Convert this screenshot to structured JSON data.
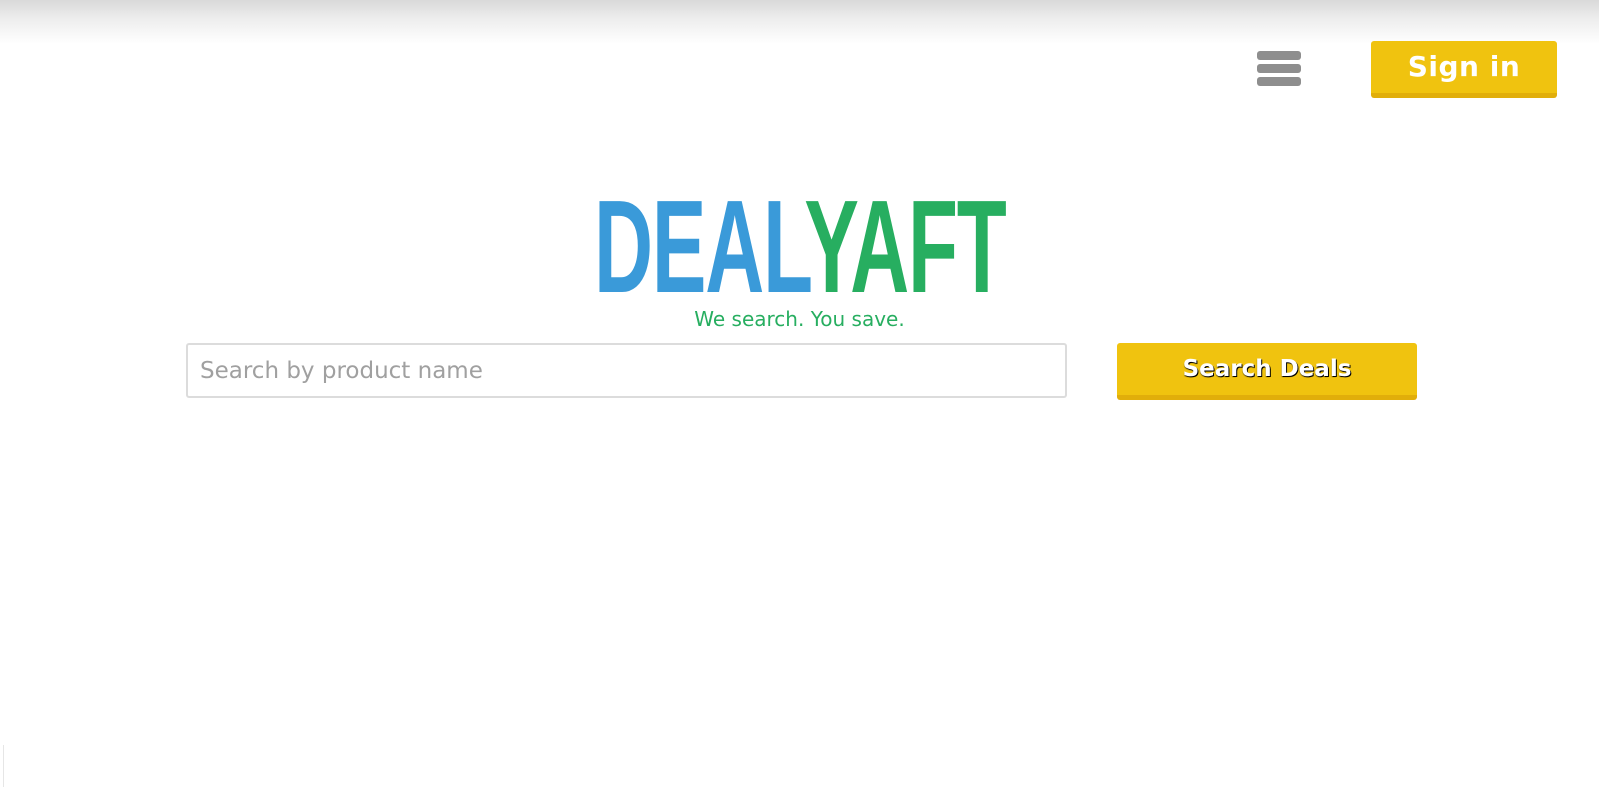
{
  "header": {
    "menu_icon": "hamburger-menu-icon",
    "signin_label": "Sign in"
  },
  "logo": {
    "part1": "DEAL",
    "part2": "YAFT",
    "tagline": "We search. You save."
  },
  "search": {
    "placeholder": "Search by product name",
    "value": "",
    "button_label": "Search Deals"
  },
  "colors": {
    "brand_blue": "#3a9ad9",
    "brand_green": "#27ae60",
    "accent_yellow": "#f0c30f",
    "menu_gray": "#8e8e8e"
  }
}
